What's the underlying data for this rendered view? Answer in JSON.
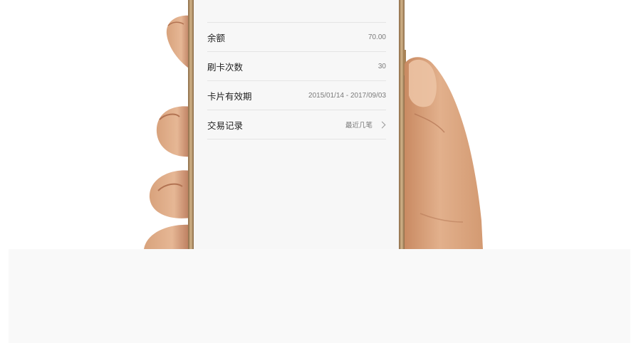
{
  "card_info": {
    "rows": [
      {
        "label": "余额",
        "value": "70.00"
      },
      {
        "label": "刷卡次数",
        "value": "30"
      },
      {
        "label": "卡片有效期",
        "value": "2015/01/14 - 2017/09/03"
      },
      {
        "label": "交易记录",
        "value": "最近几笔"
      }
    ]
  },
  "icons": {
    "transactions_arrow": "chevron-right-icon"
  },
  "colors": {
    "screen_bg": "#f7f7f7",
    "divider": "#e4e4e4",
    "label_text": "#1f1f1f",
    "value_text": "#7a7a7a",
    "phone_frame": "#b89568",
    "skin": "#d9a078",
    "bottom_panel": "#f9f9f9"
  }
}
